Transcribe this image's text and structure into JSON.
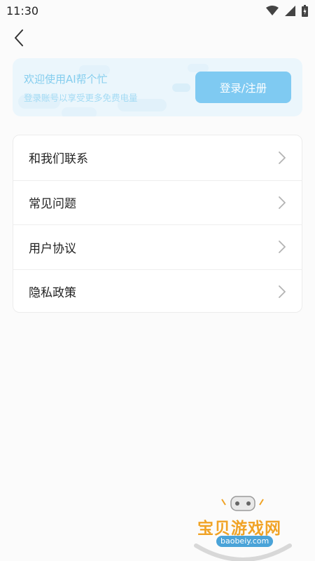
{
  "status_bar": {
    "time": "11:30",
    "icons": [
      "wifi-icon",
      "signal-icon",
      "battery-icon"
    ]
  },
  "header": {
    "back_icon": "back-arrow-icon"
  },
  "login_card": {
    "title": "欢迎使用AI帮个忙",
    "subtitle": "登录账号以享受更多免费电量",
    "button_label": "登录/注册",
    "colors": {
      "background": "#ebf6fc",
      "button": "#7fcaf2",
      "title": "#84cdee"
    }
  },
  "menu": {
    "items": [
      {
        "label": "和我们联系",
        "icon": "chevron-right-icon"
      },
      {
        "label": "常见问题",
        "icon": "chevron-right-icon"
      },
      {
        "label": "用户协议",
        "icon": "chevron-right-icon"
      },
      {
        "label": "隐私政策",
        "icon": "chevron-right-icon"
      }
    ]
  },
  "watermark": {
    "text": "宝贝游戏网",
    "url": "baobeiy.com"
  }
}
